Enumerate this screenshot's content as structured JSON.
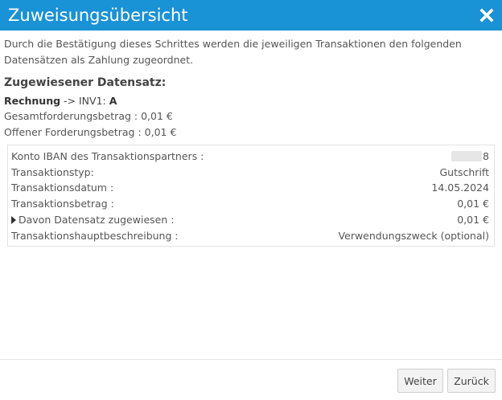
{
  "dialog": {
    "title": "Zuweisungsübersicht",
    "close_icon": "close-icon",
    "accent_color": "#1a92d6"
  },
  "intro": {
    "text": "Durch die Bestätigung dieses Schrittes werden die jeweiligen Transaktionen den folgenden Datensätzen als Zahlung zugeordnet."
  },
  "assigned": {
    "section_title": "Zugewiesener Datensatz:",
    "record_type": "Rechnung",
    "arrow": " -> ",
    "record_ref": "INV1: ",
    "record_name": "A",
    "total_label": "Gesamtforderungsbetrag :",
    "total_value": "0,01 €",
    "open_label": "Offener Forderungsbetrag :",
    "open_value": "0,01 €"
  },
  "details": {
    "rows": [
      {
        "label": "Konto IBAN des Transaktionspartners :",
        "value": "8"
      },
      {
        "label": "Transaktionstyp:",
        "value": "Gutschrift"
      },
      {
        "label": "Transaktionsdatum :",
        "value": "14.05.2024"
      },
      {
        "label": "Transaktionsbetrag :",
        "value": "0,01 €"
      },
      {
        "label": "Davon Datensatz zugewiesen :",
        "value": "0,01 €"
      },
      {
        "label": "Transaktionshauptbeschreibung :",
        "value": "Verwendungszweck (optional)"
      }
    ]
  },
  "footer": {
    "next_label": "Weiter",
    "back_label": "Zurück"
  }
}
